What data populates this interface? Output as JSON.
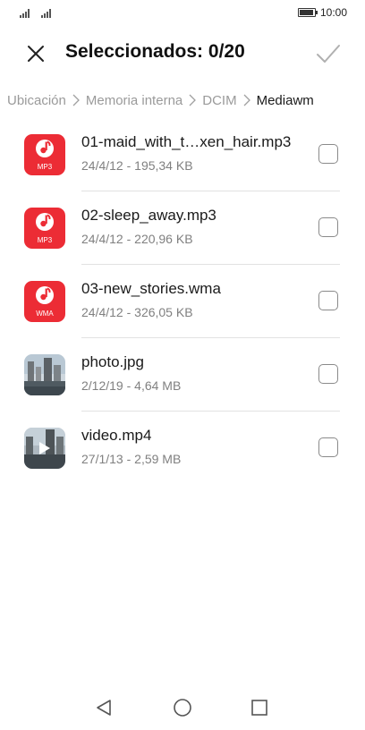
{
  "status_bar": {
    "time": "10:00",
    "signal_icons": [
      "signal-icon",
      "signal-icon"
    ],
    "battery_icon": "battery-icon",
    "battery_level": 0.95
  },
  "app_bar": {
    "close_icon": "close-icon",
    "title": "Seleccionados: 0/20",
    "confirm_icon": "check-icon"
  },
  "breadcrumb": {
    "items": [
      "Ubicación",
      "Memoria interna",
      "DCIM",
      "Mediawm"
    ],
    "separator_icon": "chevron-right-icon"
  },
  "files": [
    {
      "name": "01-maid_with_t…xen_hair.mp3",
      "meta": "24/4/12 - 195,34 KB",
      "icon": "music-file-icon",
      "ext": "MP3",
      "checked": false
    },
    {
      "name": "02-sleep_away.mp3",
      "meta": "24/4/12 - 220,96 KB",
      "icon": "music-file-icon",
      "ext": "MP3",
      "checked": false
    },
    {
      "name": "03-new_stories.wma",
      "meta": "24/4/12 - 326,05 KB",
      "icon": "music-file-icon",
      "ext": "WMA",
      "checked": false
    },
    {
      "name": "photo.jpg",
      "meta": "2/12/19 - 4,64 MB",
      "icon": "image-thumbnail",
      "checked": false
    },
    {
      "name": "video.mp4",
      "meta": "27/1/13 - 2,59 MB",
      "icon": "video-thumbnail",
      "checked": false
    }
  ],
  "nav_bar": {
    "back_icon": "back-triangle-icon",
    "home_icon": "home-circle-icon",
    "recents_icon": "recents-square-icon"
  },
  "colors": {
    "accent_red": "#ec2c35",
    "text_primary": "#1a1a1a",
    "text_secondary": "#808080",
    "breadcrumb_inactive": "#9a9a9a"
  }
}
